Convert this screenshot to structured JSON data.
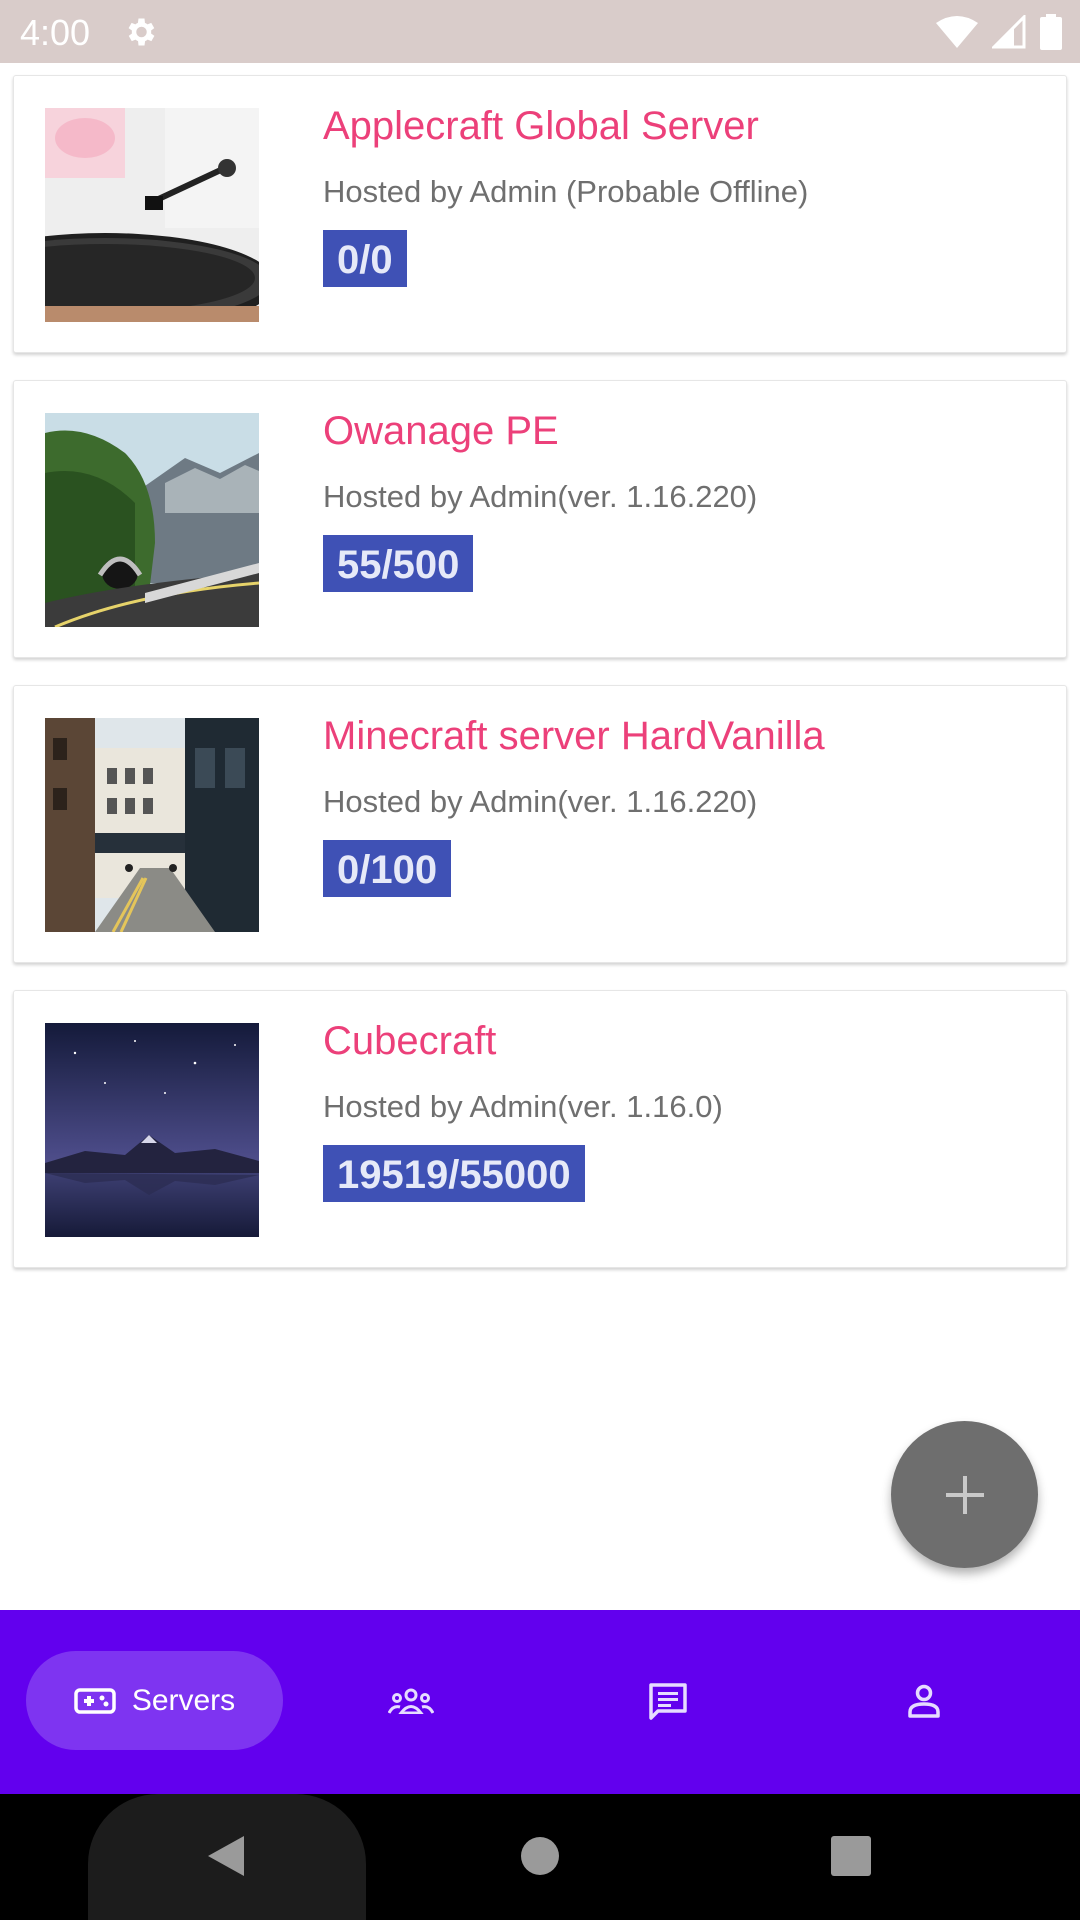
{
  "status_bar": {
    "time": "4:00",
    "icons": [
      "settings-icon",
      "wifi-icon",
      "signal-icon",
      "battery-icon"
    ]
  },
  "servers": [
    {
      "title": "Applecraft Global Server",
      "subtitle": "Hosted by Admin (Probable Offline)",
      "players": "0/0",
      "image": "turntable"
    },
    {
      "title": "Owanage PE",
      "subtitle": "Hosted by Admin(ver. 1.16.220)",
      "players": "55/500",
      "image": "mountain-road"
    },
    {
      "title": "Minecraft server HardVanilla",
      "subtitle": "Hosted by Admin(ver. 1.16.220)",
      "players": "0/100",
      "image": "city-street"
    },
    {
      "title": "Cubecraft",
      "subtitle": "Hosted by Admin(ver. 1.16.0)",
      "players": "19519/55000",
      "image": "night-lake"
    }
  ],
  "fab": {
    "icon": "plus-icon"
  },
  "bottom_nav": {
    "active_label": "Servers",
    "items": [
      {
        "icon": "gamepad-icon",
        "label": "Servers",
        "active": true
      },
      {
        "icon": "group-icon"
      },
      {
        "icon": "chat-icon"
      },
      {
        "icon": "person-icon"
      }
    ]
  },
  "colors": {
    "title": "#ec407a",
    "badge": "#3f51b5",
    "nav_bg": "#6200ee",
    "nav_active": "#7e34f1",
    "fab": "#6e6e6e",
    "status_bar": "#d9ccca"
  }
}
